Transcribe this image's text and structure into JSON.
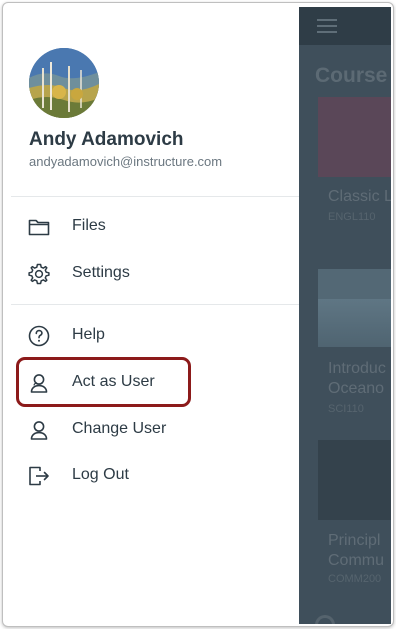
{
  "background_app": {
    "courses_title": "Course",
    "cards": [
      {
        "title": "Classic L",
        "title_line2": "",
        "code": "ENGL110"
      },
      {
        "title": "Introduc",
        "title_line2": "Oceano",
        "code": "SCI110"
      },
      {
        "title": "Principl",
        "title_line2": "Commu",
        "code": "COMM200"
      }
    ]
  },
  "profile": {
    "name": "Andy Adamovich",
    "email": "andyadamovich@instructure.com"
  },
  "menu": {
    "files": {
      "label": "Files",
      "icon": "folder-icon"
    },
    "settings": {
      "label": "Settings",
      "icon": "gear-icon"
    },
    "help": {
      "label": "Help",
      "icon": "question-circle-icon"
    },
    "act_as_user": {
      "label": "Act as User",
      "icon": "user-icon"
    },
    "change_user": {
      "label": "Change User",
      "icon": "user-icon"
    },
    "log_out": {
      "label": "Log Out",
      "icon": "logout-icon"
    }
  },
  "colors": {
    "highlight_border": "#8c1a1a",
    "text_primary": "#2d3b45",
    "overlay": "#3f4f5b"
  }
}
